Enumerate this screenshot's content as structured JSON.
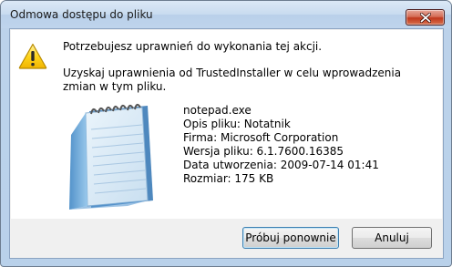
{
  "window": {
    "title": "Odmowa dostępu do pliku"
  },
  "message": {
    "line1": "Potrzebujesz uprawnień do wykonania tej akcji.",
    "line2": "Uzyskaj uprawnienia od TrustedInstaller w celu wprowadzenia zmian w tym pliku."
  },
  "file": {
    "name": "notepad.exe",
    "description": "Opis pliku: Notatnik",
    "company": "Firma: Microsoft Corporation",
    "version": "Wersja pliku: 6.1.7600.16385",
    "created": "Data utworzenia: 2009-07-14 01:41",
    "size": "Rozmiar: 175 KB"
  },
  "buttons": {
    "retry": "Próbuj ponownie",
    "cancel": "Anuluj"
  },
  "icons": {
    "warning": "warning-icon",
    "file": "notepad-icon",
    "close": "close-icon"
  },
  "colors": {
    "title_bar": "#bfd4ec",
    "close_button": "#c0381d",
    "warning": "#f5c400",
    "default_button_border": "#3c7fb1"
  }
}
